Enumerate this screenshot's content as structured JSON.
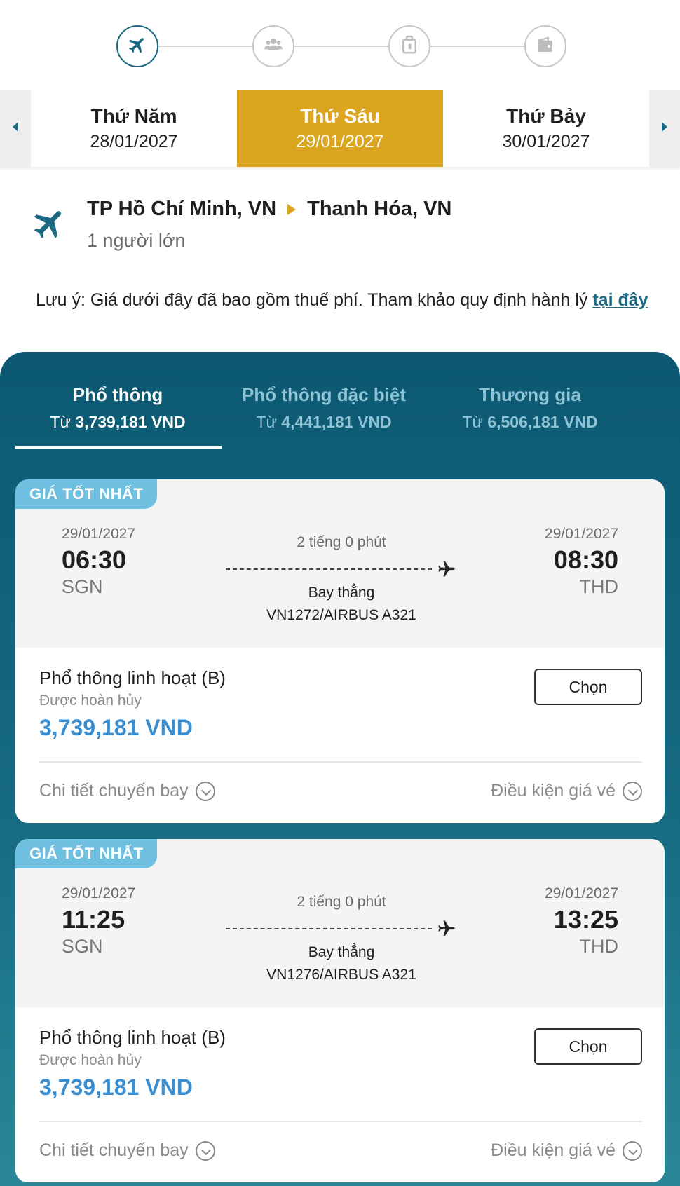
{
  "stepper": {
    "steps": [
      {
        "icon": "plane-icon",
        "active": true
      },
      {
        "icon": "passengers-icon",
        "active": false
      },
      {
        "icon": "baggage-icon",
        "active": false
      },
      {
        "icon": "wallet-icon",
        "active": false
      }
    ]
  },
  "date_bar": {
    "prev": {
      "day": "Thứ Năm",
      "date": "28/01/2027"
    },
    "current": {
      "day": "Thứ Sáu",
      "date": "29/01/2027"
    },
    "next": {
      "day": "Thứ Bảy",
      "date": "30/01/2027"
    }
  },
  "route": {
    "origin": "TP Hồ Chí Minh, VN",
    "destination": "Thanh Hóa, VN",
    "passengers": "1 người lớn"
  },
  "note": {
    "text": "Lưu ý: Giá dưới đây đã bao gồm thuế phí. Tham khảo quy định hành lý ",
    "link": "tại đây"
  },
  "cabin_tabs": [
    {
      "name": "Phổ thông",
      "prefix": "Từ ",
      "price": "3,739,181 VND",
      "active": true
    },
    {
      "name": "Phổ thông đặc biệt",
      "prefix": "Từ ",
      "price": "4,441,181 VND",
      "active": false
    },
    {
      "name": "Thương gia",
      "prefix": "Từ ",
      "price": "6,506,181 VND",
      "active": false
    }
  ],
  "flights": [
    {
      "badge": "GIÁ TỐT NHẤT",
      "dep_date": "29/01/2027",
      "dep_time": "06:30",
      "dep_code": "SGN",
      "arr_date": "29/01/2027",
      "arr_time": "08:30",
      "arr_code": "THD",
      "duration": "2 tiếng 0 phút",
      "stops": "Bay thẳng",
      "flight_no": "VN1272/AIRBUS A321",
      "fare_name": "Phổ thông linh hoạt (B)",
      "refund": "Được hoàn hủy",
      "price": "3,739,181 VND",
      "choose": "Chọn",
      "details": "Chi tiết chuyến bay",
      "conditions": "Điều kiện giá vé"
    },
    {
      "badge": "GIÁ TỐT NHẤT",
      "dep_date": "29/01/2027",
      "dep_time": "11:25",
      "dep_code": "SGN",
      "arr_date": "29/01/2027",
      "arr_time": "13:25",
      "arr_code": "THD",
      "duration": "2 tiếng 0 phút",
      "stops": "Bay thẳng",
      "flight_no": "VN1276/AIRBUS A321",
      "fare_name": "Phổ thông linh hoạt (B)",
      "refund": "Được hoàn hủy",
      "price": "3,739,181 VND",
      "choose": "Chọn",
      "details": "Chi tiết chuyến bay",
      "conditions": "Điều kiện giá vé"
    }
  ],
  "colors": {
    "accent": "#dba520",
    "panel": "#0c5872",
    "price": "#3a8ed0",
    "badge": "#6fc0e0"
  }
}
